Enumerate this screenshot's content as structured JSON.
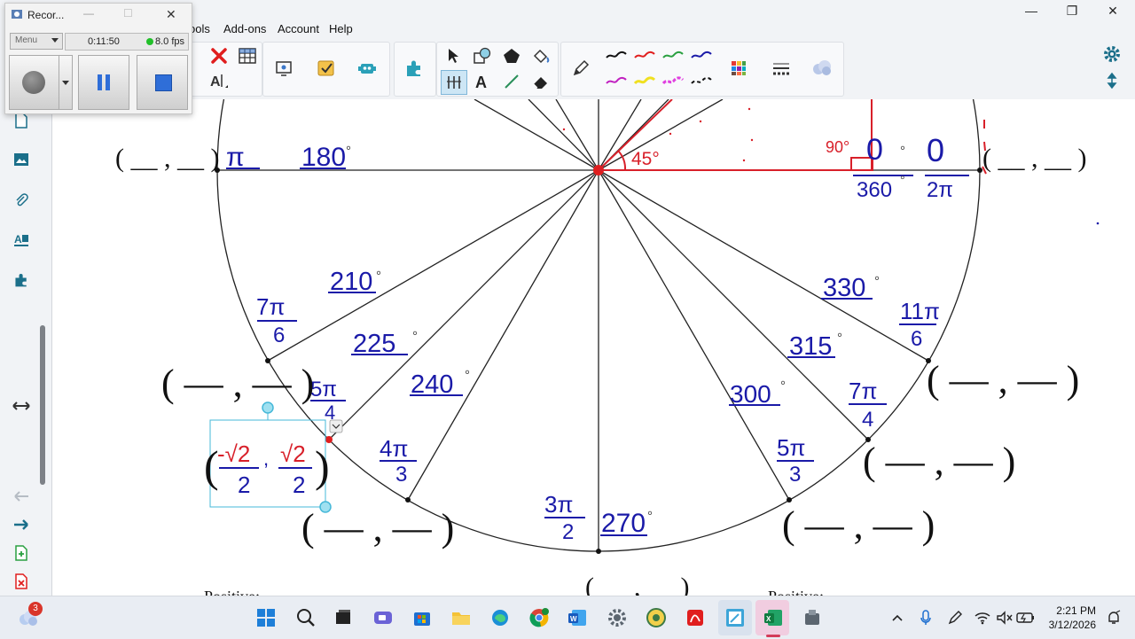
{
  "menu": {
    "items": [
      "ools",
      "Add-ons",
      "Account",
      "Help"
    ]
  },
  "window_controls": {
    "minimize": "—",
    "restore": "❐",
    "close": "✕"
  },
  "recorder": {
    "title": "Recor...",
    "menu_label": "Menu",
    "elapsed": "0:11:50",
    "fps": "8.0 fps",
    "controls": {
      "minimize": "—",
      "maximize": "☐",
      "close": "✕"
    }
  },
  "colors": {
    "ink_blue": "#1a1aa8",
    "ink_red": "#d8202a",
    "selection": "#45b8d8",
    "accent_red": "#e01e1e",
    "excel_green": "#1d7a45"
  },
  "diagram": {
    "degree_symbol": "°",
    "pair_blank": "( __ , __ )",
    "pair_blank_large": "( — , — )",
    "angles_deg": [
      "180",
      "210",
      "225",
      "240",
      "270",
      "300",
      "315",
      "330",
      "360",
      "0",
      "45",
      "90"
    ],
    "radians": {
      "pi": "π",
      "r7pi6": [
        "7π",
        "6"
      ],
      "r5pi4": [
        "5π",
        "4"
      ],
      "r4pi3": [
        "4π",
        "3"
      ],
      "r3pi2": [
        "3π",
        "2"
      ],
      "r5pi3": [
        "5π",
        "3"
      ],
      "r7pi4": [
        "7π",
        "4"
      ],
      "r11pi6": [
        "11π",
        "6"
      ],
      "zero": "0",
      "two_pi": "2π"
    },
    "coordinate_answer": {
      "x_num": "-√2",
      "x_den": "2",
      "y_num": "√2",
      "y_den": "2"
    },
    "positive_left": "Positive:",
    "positive_right": "Positive:"
  },
  "taskbar": {
    "weather_badge": "3",
    "time": "2:21 PM",
    "date": "3/12/2026"
  }
}
